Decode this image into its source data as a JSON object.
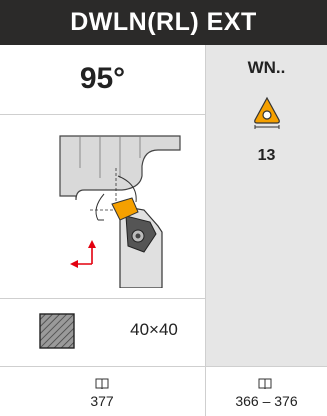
{
  "header": {
    "title": "DWLN(RL) EXT"
  },
  "angle": {
    "value": "95°"
  },
  "insert": {
    "code": "WN..",
    "size": "13",
    "icon": "trigon-insert-icon"
  },
  "diagram": {
    "icon": "toolholder-diagram",
    "accent_color": "#f5a000",
    "arrow_color": "#e3000f"
  },
  "shank": {
    "icon": "shank-cross-section-icon",
    "size": "40×40"
  },
  "pages": {
    "holder_page": "377",
    "insert_pages": "366 – 376",
    "icon": "book-icon"
  },
  "colors": {
    "header_bg": "#2b2a29",
    "column_bg": "#e6e6e6",
    "accent": "#f5a000"
  }
}
